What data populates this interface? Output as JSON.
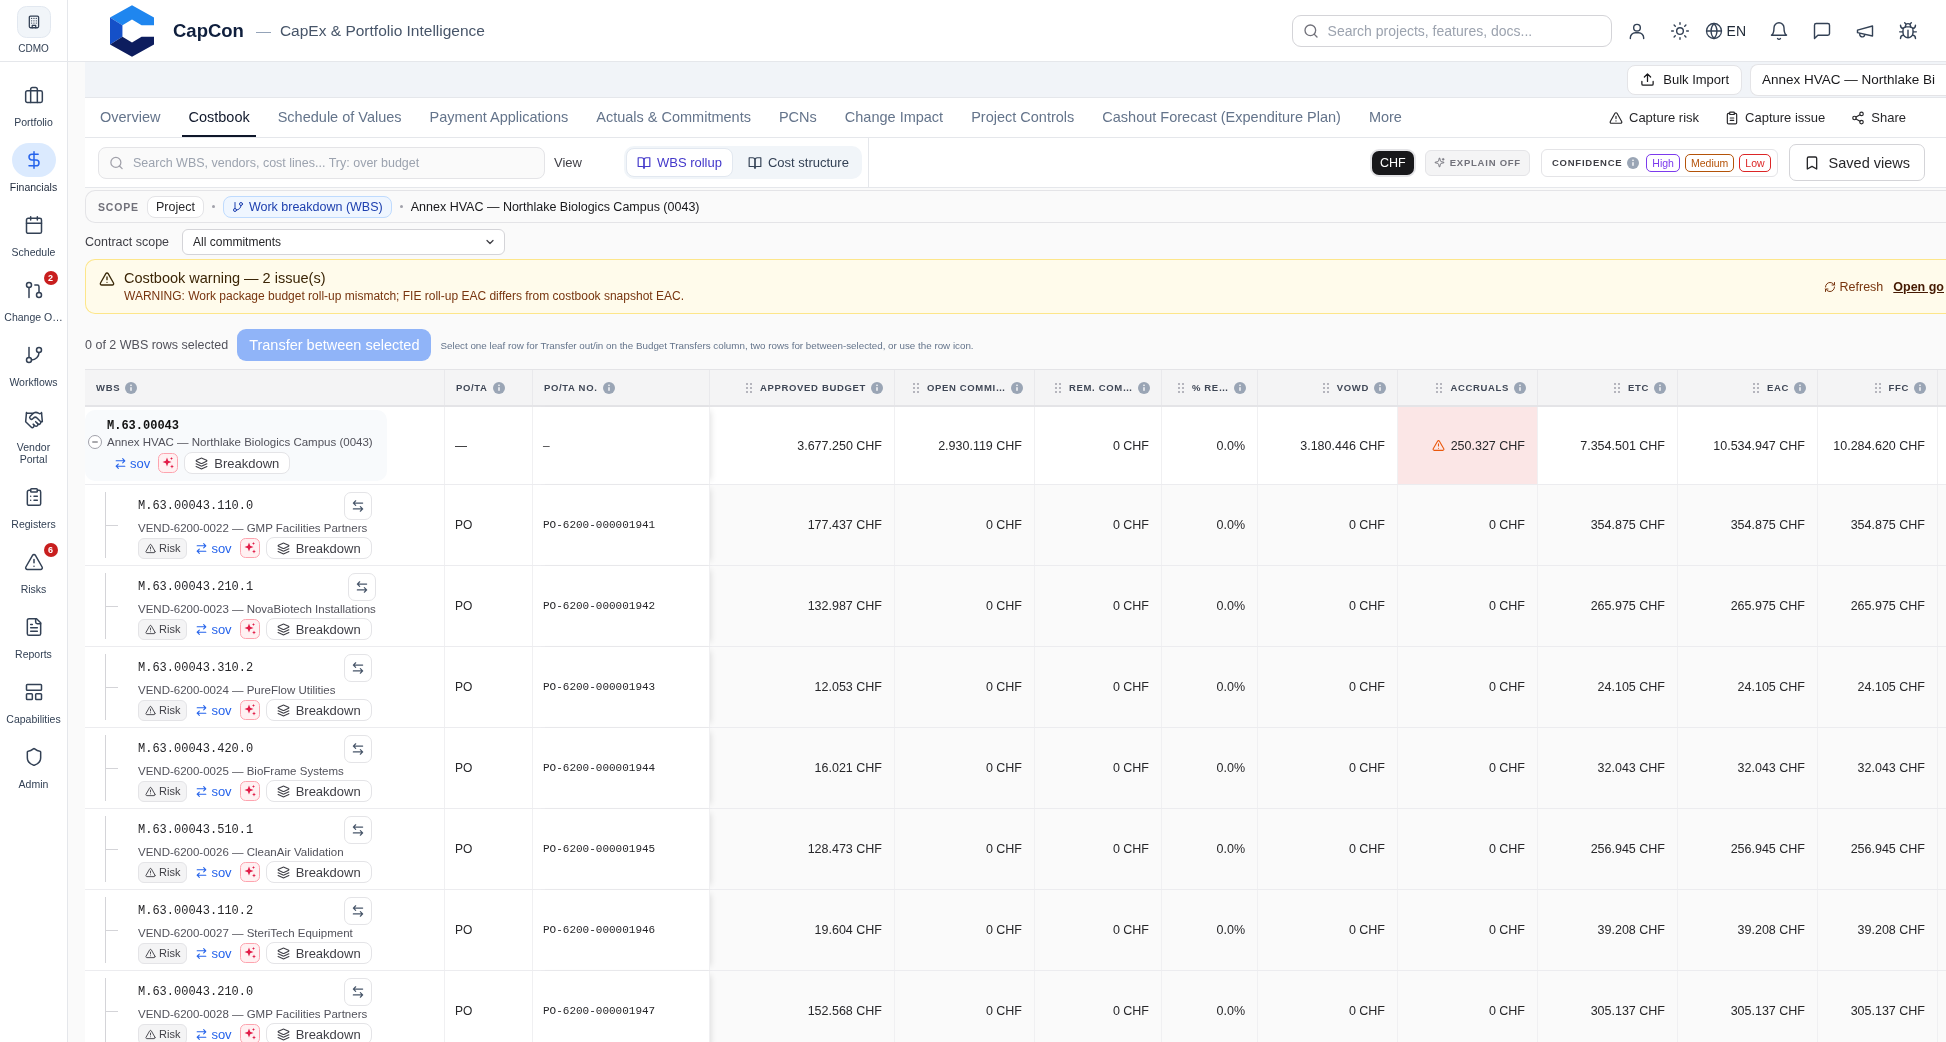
{
  "sidebar": {
    "org": "CDMO",
    "items": [
      {
        "label": "Portfolio",
        "selected": false
      },
      {
        "label": "Financials",
        "selected": true
      },
      {
        "label": "Schedule",
        "selected": false
      },
      {
        "label": "Change O…",
        "selected": false,
        "badge": "2"
      },
      {
        "label": "Workflows",
        "selected": false
      },
      {
        "label": "Vendor Portal",
        "selected": false
      },
      {
        "label": "Registers",
        "selected": false
      },
      {
        "label": "Risks",
        "selected": false,
        "badge": "6"
      },
      {
        "label": "Reports",
        "selected": false
      },
      {
        "label": "Capabilities",
        "selected": false
      },
      {
        "label": "Admin",
        "selected": false
      }
    ]
  },
  "header": {
    "brand": "CapCon",
    "separator": "—",
    "tagline": "CapEx & Portfolio Intelligence",
    "search": {
      "placeholder": "Search projects, features, docs..."
    },
    "language": "EN"
  },
  "project_bar": {
    "bulk_import": "Bulk Import",
    "project": "Annex HVAC — Northlake Bi"
  },
  "tabs": {
    "items": [
      {
        "label": "Overview",
        "selected": false
      },
      {
        "label": "Costbook",
        "selected": true
      },
      {
        "label": "Schedule of Values",
        "selected": false
      },
      {
        "label": "Payment Applications",
        "selected": false
      },
      {
        "label": "Actuals & Commitments",
        "selected": false
      },
      {
        "label": "PCNs",
        "selected": false
      },
      {
        "label": "Change Impact",
        "selected": false
      },
      {
        "label": "Project Controls",
        "selected": false
      },
      {
        "label": "Cashout Forecast (Expenditure Plan)",
        "selected": false
      },
      {
        "label": "More",
        "selected": false
      }
    ],
    "actions": [
      "Capture risk",
      "Capture issue",
      "Share"
    ]
  },
  "toolbar": {
    "search": {
      "placeholder": "Search WBS, vendors, cost lines... Try: over budget"
    },
    "view_label": "View",
    "view_options": [
      {
        "label": "WBS rollup",
        "selected": true
      },
      {
        "label": "Cost structure",
        "selected": false
      }
    ],
    "currency": "CHF",
    "explain": {
      "label": "EXPLAIN OFF",
      "on": false
    },
    "confidence": {
      "label": "CONFIDENCE",
      "levels": [
        {
          "label": "High",
          "color": "#7c3aed"
        },
        {
          "label": "Medium",
          "color": "#b45309"
        },
        {
          "label": "Low",
          "color": "#dc2626"
        }
      ]
    },
    "saved_views": "Saved views"
  },
  "scope": {
    "label": "SCOPE",
    "levels": [
      {
        "label": "Project",
        "selected": false
      },
      {
        "label": "Work breakdown (WBS)",
        "selected": true
      }
    ],
    "current": "Annex HVAC — Northlake Biologics Campus (0043)"
  },
  "contract_scope": {
    "label": "Contract scope",
    "value": "All commitments"
  },
  "warning": {
    "title": "Costbook warning — 2 issue(s)",
    "message": "WARNING: Work package budget roll-up mismatch; FIE roll-up EAC differs from costbook snapshot EAC.",
    "refresh": "Refresh",
    "link": "Open go"
  },
  "selection": {
    "summary": "0 of 2 WBS rows selected",
    "transfer": {
      "label": "Transfer between selected",
      "disabled": true
    },
    "hint": "Select one leaf row for Transfer out/in on the Budget Transfers column, two rows for between-selected, or use the row icon."
  },
  "table": {
    "columns": [
      {
        "label": "WBS",
        "kind": "text"
      },
      {
        "label": "PO/TA",
        "kind": "text"
      },
      {
        "label": "PO/TA NO.",
        "kind": "text"
      },
      {
        "label": "APPROVED BUDGET",
        "kind": "number"
      },
      {
        "label": "OPEN COMMI…",
        "kind": "number"
      },
      {
        "label": "REM. COM…",
        "kind": "number"
      },
      {
        "label": "% RE…",
        "kind": "number"
      },
      {
        "label": "VOWD",
        "kind": "number"
      },
      {
        "label": "ACCRUALS",
        "kind": "number"
      },
      {
        "label": "ETC",
        "kind": "number"
      },
      {
        "label": "EAC",
        "kind": "number"
      },
      {
        "label": "FFC",
        "kind": "number"
      }
    ],
    "rows": [
      {
        "code": "M.63.00043",
        "name": "Annex HVAC — Northlake Biologics Campus (0043)",
        "expanded": true,
        "actions": {
          "sov": "sov",
          "breakdown": "Breakdown"
        },
        "po_ta": "—",
        "po_ta_no": "—",
        "values": [
          "3.677.250 CHF",
          "2.930.119 CHF",
          "0 CHF",
          "0.0%",
          "3.180.446 CHF",
          "250.327 CHF",
          "7.354.501 CHF",
          "10.534.947 CHF",
          "10.284.620 CHF"
        ],
        "accruals_alert": true,
        "children": [
          {
            "code": "M.63.00043.110.0",
            "vendor": "VEND-6200-0022 — GMP Facilities Partners",
            "actions": {
              "risk": "Risk",
              "sov": "sov",
              "breakdown": "Breakdown"
            },
            "po_ta": "PO",
            "po_ta_no": "PO-6200-000001941",
            "values": [
              "177.437 CHF",
              "0 CHF",
              "0 CHF",
              "0.0%",
              "0 CHF",
              "0 CHF",
              "354.875 CHF",
              "354.875 CHF",
              "354.875 CHF"
            ],
            "accruals_alert": false
          },
          {
            "code": "M.63.00043.210.1",
            "vendor": "VEND-6200-0023 — NovaBiotech Installations",
            "actions": {
              "risk": "Risk",
              "sov": "sov",
              "breakdown": "Breakdown"
            },
            "po_ta": "PO",
            "po_ta_no": "PO-6200-000001942",
            "values": [
              "132.987 CHF",
              "0 CHF",
              "0 CHF",
              "0.0%",
              "0 CHF",
              "0 CHF",
              "265.975 CHF",
              "265.975 CHF",
              "265.975 CHF"
            ],
            "accruals_alert": false
          },
          {
            "code": "M.63.00043.310.2",
            "vendor": "VEND-6200-0024 — PureFlow Utilities",
            "actions": {
              "risk": "Risk",
              "sov": "sov",
              "breakdown": "Breakdown"
            },
            "po_ta": "PO",
            "po_ta_no": "PO-6200-000001943",
            "values": [
              "12.053 CHF",
              "0 CHF",
              "0 CHF",
              "0.0%",
              "0 CHF",
              "0 CHF",
              "24.105 CHF",
              "24.105 CHF",
              "24.105 CHF"
            ],
            "accruals_alert": false
          },
          {
            "code": "M.63.00043.420.0",
            "vendor": "VEND-6200-0025 — BioFrame Systems",
            "actions": {
              "risk": "Risk",
              "sov": "sov",
              "breakdown": "Breakdown"
            },
            "po_ta": "PO",
            "po_ta_no": "PO-6200-000001944",
            "values": [
              "16.021 CHF",
              "0 CHF",
              "0 CHF",
              "0.0%",
              "0 CHF",
              "0 CHF",
              "32.043 CHF",
              "32.043 CHF",
              "32.043 CHF"
            ],
            "accruals_alert": false
          },
          {
            "code": "M.63.00043.510.1",
            "vendor": "VEND-6200-0026 — CleanAir Validation",
            "actions": {
              "risk": "Risk",
              "sov": "sov",
              "breakdown": "Breakdown"
            },
            "po_ta": "PO",
            "po_ta_no": "PO-6200-000001945",
            "values": [
              "128.473 CHF",
              "0 CHF",
              "0 CHF",
              "0.0%",
              "0 CHF",
              "0 CHF",
              "256.945 CHF",
              "256.945 CHF",
              "256.945 CHF"
            ],
            "accruals_alert": false
          },
          {
            "code": "M.63.00043.110.2",
            "vendor": "VEND-6200-0027 — SteriTech Equipment",
            "actions": {
              "risk": "Risk",
              "sov": "sov",
              "breakdown": "Breakdown"
            },
            "po_ta": "PO",
            "po_ta_no": "PO-6200-000001946",
            "values": [
              "19.604 CHF",
              "0 CHF",
              "0 CHF",
              "0.0%",
              "0 CHF",
              "0 CHF",
              "39.208 CHF",
              "39.208 CHF",
              "39.208 CHF"
            ],
            "accruals_alert": false
          },
          {
            "code": "M.63.00043.210.0",
            "vendor": "VEND-6200-0028 — GMP Facilities Partners",
            "actions": {
              "risk": "Risk",
              "sov": "sov",
              "breakdown": "Breakdown"
            },
            "po_ta": "PO",
            "po_ta_no": "PO-6200-000001947",
            "values": [
              "152.568 CHF",
              "0 CHF",
              "0 CHF",
              "0.0%",
              "0 CHF",
              "0 CHF",
              "305.137 CHF",
              "305.137 CHF",
              "305.137 CHF"
            ],
            "accruals_alert": false
          }
        ]
      }
    ]
  }
}
